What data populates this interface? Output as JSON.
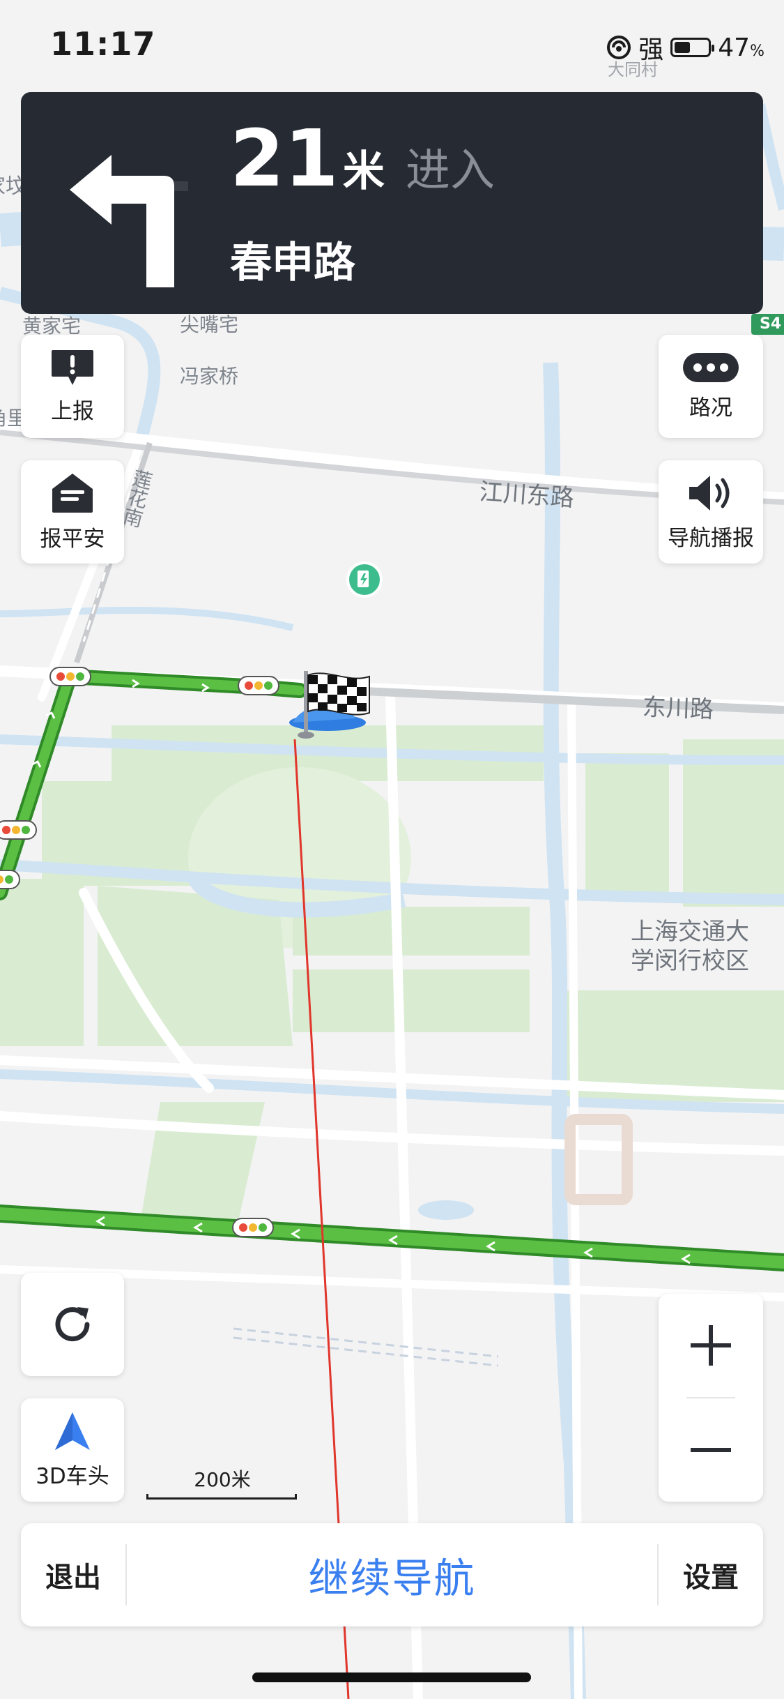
{
  "status_bar": {
    "time": "11:17",
    "signal_text": "强",
    "battery_percent": "47",
    "battery_unit": "%",
    "battery_level": 0.47
  },
  "guidance": {
    "distance": "21",
    "distance_unit": "米",
    "action": "进入",
    "road_name": "春申路",
    "maneuver_icon": "turn-left-arrow-icon"
  },
  "map": {
    "labels": [
      "大同村",
      "家坟",
      "黄家宅",
      "尖嘴宅",
      "冯家桥",
      "角里",
      "江川东路",
      "莲花南",
      "东川路",
      "上海交通大",
      "学闵行校区",
      "S4"
    ],
    "route_color": "#4fb63e",
    "line_color": "#e0362b"
  },
  "left_controls": {
    "report": "上报",
    "safety": "报平安",
    "refresh_icon": "refresh-icon",
    "view_mode": "3D车头"
  },
  "right_controls": {
    "traffic": "路况",
    "voice": "导航播报",
    "zoom_in": "+",
    "zoom_out": "−"
  },
  "scale_bar": {
    "label": "200米"
  },
  "bottom_bar": {
    "exit": "退出",
    "continue": "继续导航",
    "settings": "设置"
  }
}
